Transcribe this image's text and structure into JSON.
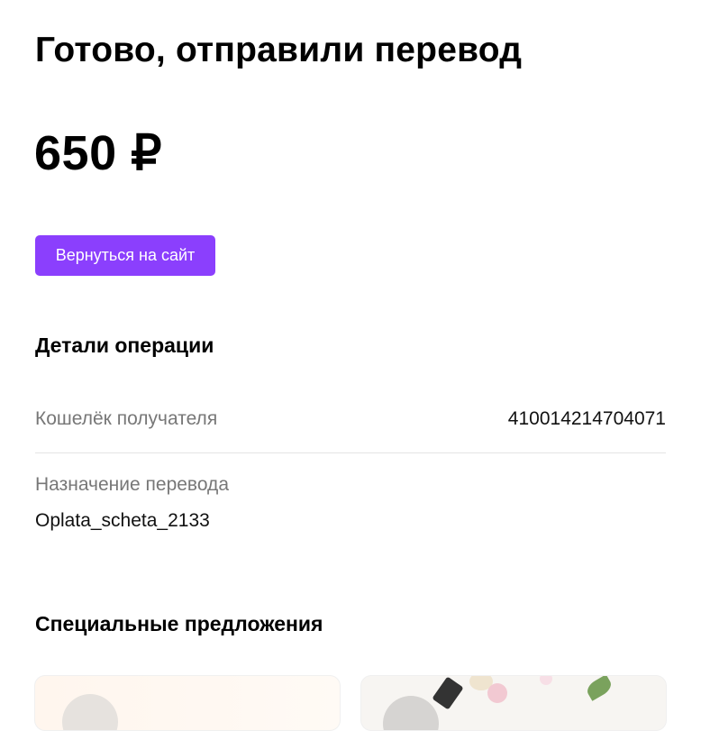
{
  "header": {
    "title": "Готово, отправили перевод"
  },
  "payment": {
    "amount": "650 ₽"
  },
  "actions": {
    "back_label": "Вернуться на сайт"
  },
  "details": {
    "title": "Детали операции",
    "wallet_label": "Кошелёк получателя",
    "wallet_value": "410014214704071",
    "purpose_label": "Назначение перевода",
    "purpose_value": "Oplata_scheta_2133"
  },
  "offers": {
    "title": "Специальные предложения",
    "cards": [
      {
        "icon": "offer-logo-circle"
      },
      {
        "icon": "offer-logo-circle"
      }
    ]
  },
  "colors": {
    "accent": "#8b3ffd",
    "muted_text": "#777777",
    "divider": "#e4e4e4"
  }
}
